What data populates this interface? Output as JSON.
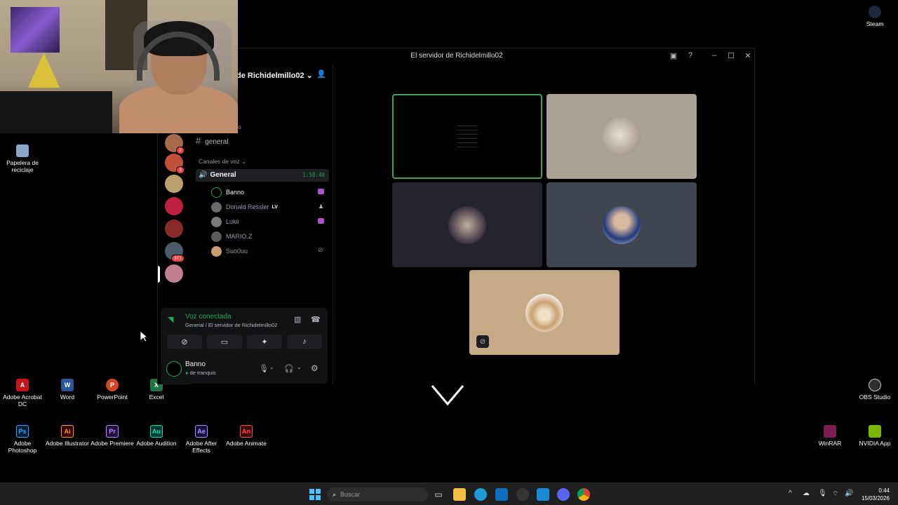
{
  "window": {
    "title": "El servidor de Richidelmillo02"
  },
  "desktop_icons": [
    {
      "label": "Papelera de reciclaje",
      "abbr": "",
      "color": "#8aa6c8"
    },
    {
      "label": "Adobe Acrobat DC",
      "abbr": "A",
      "color": "#c4161c"
    },
    {
      "label": "Word",
      "abbr": "W",
      "color": "#2b579a"
    },
    {
      "label": "PowerPoint",
      "abbr": "P",
      "color": "#d24726"
    },
    {
      "label": "Excel",
      "abbr": "X",
      "color": "#217346"
    },
    {
      "label": "Adobe Photoshop",
      "abbr": "Ps",
      "color": "#001e36"
    },
    {
      "label": "Adobe Illustrator",
      "abbr": "Ai",
      "color": "#330000"
    },
    {
      "label": "Adobe Premiere",
      "abbr": "Pr",
      "color": "#2a0b3d"
    },
    {
      "label": "Adobe Audition",
      "abbr": "Au",
      "color": "#003a32"
    },
    {
      "label": "Adobe After Effects",
      "abbr": "Ae",
      "color": "#1a0f3a"
    },
    {
      "label": "Adobe Animate",
      "abbr": "An",
      "color": "#3a0a0a"
    },
    {
      "label": "Steam",
      "abbr": "",
      "color": "#1b2838"
    },
    {
      "label": "OBS Studio",
      "abbr": "",
      "color": "#302e31"
    },
    {
      "label": "WinRAR",
      "abbr": "",
      "color": "#7a1f4f"
    },
    {
      "label": "NVIDIA App",
      "abbr": "",
      "color": "#76b900"
    }
  ],
  "server": {
    "name": "de Richidelmillo02",
    "truncated": "to"
  },
  "servers": [
    {
      "badge": "2",
      "color": "#a46a4a"
    },
    {
      "badge": "3",
      "color": "#c0503a"
    },
    {
      "badge": "",
      "color": "#b9a06e"
    },
    {
      "badge": "",
      "color": "#c02040"
    },
    {
      "badge": "",
      "color": "#8a2a2a"
    },
    {
      "badge": "371",
      "color": "#4a5a6a"
    },
    {
      "badge": "",
      "color": "#c08090"
    }
  ],
  "channels": {
    "text_channel": "general",
    "voice_category": "Canales de voz",
    "voice_channel": "General",
    "timer": "1:58:40",
    "users": [
      {
        "name": "Banno",
        "tag": "",
        "color": "#23a55a"
      },
      {
        "name": "Donald Ressler",
        "tag": "LV",
        "color": "#6a6a6a"
      },
      {
        "name": "Lukii",
        "tag": "",
        "color": "#7a7a7a"
      },
      {
        "name": "MARIO.Z",
        "tag": "",
        "color": "#5a5a5a"
      },
      {
        "name": "Suo0uu",
        "tag": "",
        "color": "#c8a070"
      }
    ]
  },
  "voice_panel": {
    "status": "Voz conectada",
    "location": "General / El servidor de Richidelmillo02",
    "user": "Banno",
    "user_status": "de tranquis"
  },
  "taskbar": {
    "search_placeholder": "Buscar",
    "time": "0:44",
    "date": "15/03/2026"
  },
  "colors": {
    "accent_green": "#23a55a",
    "tile_border": "#3ba55c"
  }
}
